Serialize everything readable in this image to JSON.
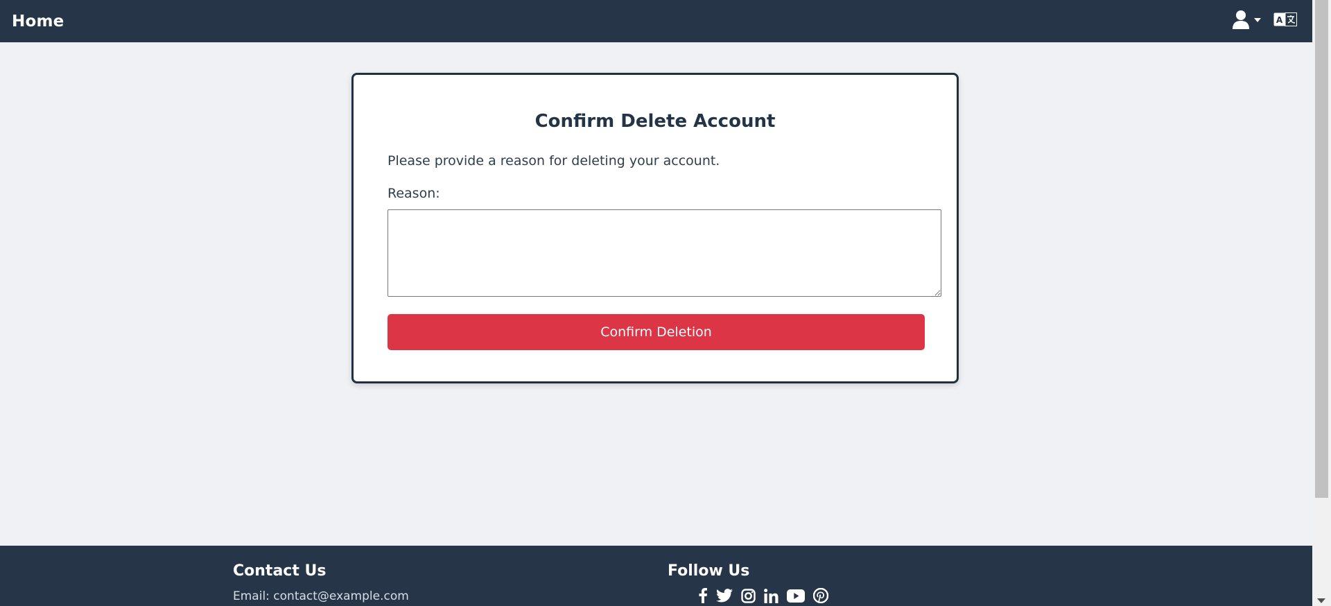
{
  "nav": {
    "brand": "Home",
    "user_icon": "user-icon",
    "language_icon": "translate-icon"
  },
  "card": {
    "title": "Confirm Delete Account",
    "instruction": "Please provide a reason for deleting your account.",
    "reason_label": "Reason:",
    "reason_value": "",
    "reason_placeholder": "",
    "confirm_label": "Confirm Deletion"
  },
  "footer": {
    "contact_heading": "Contact Us",
    "contact_email": "Email: contact@example.com",
    "follow_heading": "Follow Us",
    "social_icons": [
      "facebook-icon",
      "twitter-icon",
      "instagram-icon",
      "linkedin-icon",
      "youtube-icon",
      "pinterest-icon"
    ]
  },
  "colors": {
    "navbar_bg": "#263547",
    "page_bg": "#eff1f4",
    "danger": "#dc3545",
    "text": "#243447"
  }
}
